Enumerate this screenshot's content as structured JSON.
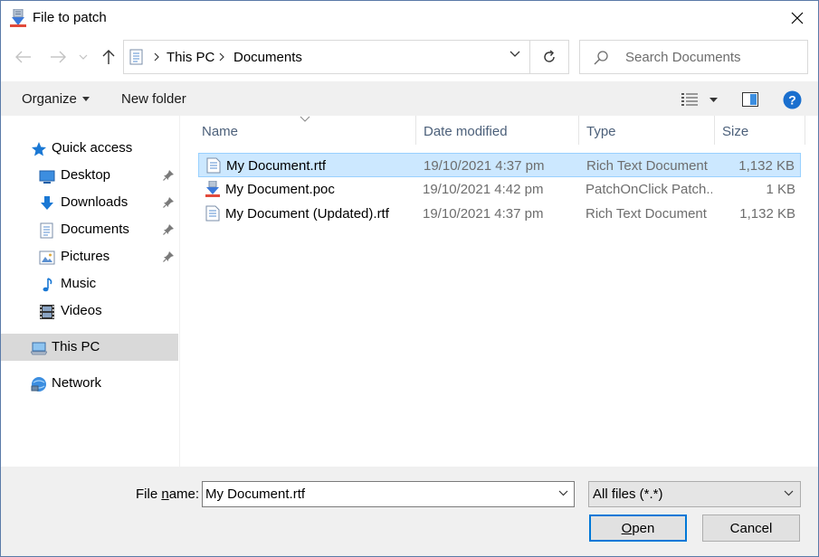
{
  "window": {
    "title": "File to patch",
    "close_glyph": "✕"
  },
  "nav": {
    "breadcrumbs": [
      "This PC",
      "Documents"
    ],
    "search_placeholder": "Search Documents"
  },
  "commands": {
    "organize": "Organize",
    "new_folder": "New folder",
    "help_glyph": "?"
  },
  "sidebar": {
    "items": [
      {
        "label": "Quick access",
        "icon": "star-icon"
      },
      {
        "label": "Desktop",
        "icon": "desktop-icon",
        "pinned": true
      },
      {
        "label": "Downloads",
        "icon": "download-icon",
        "pinned": true
      },
      {
        "label": "Documents",
        "icon": "documents-icon",
        "pinned": true
      },
      {
        "label": "Pictures",
        "icon": "pictures-icon",
        "pinned": true
      },
      {
        "label": "Music",
        "icon": "music-icon"
      },
      {
        "label": "Videos",
        "icon": "videos-icon"
      },
      {
        "label": "This PC",
        "icon": "computer-icon",
        "selected": true
      },
      {
        "label": "Network",
        "icon": "network-icon"
      }
    ]
  },
  "table": {
    "columns": [
      "Name",
      "Date modified",
      "Type",
      "Size"
    ],
    "rows": [
      {
        "name": "My Document.rtf",
        "date": "19/10/2021 4:37 pm",
        "type": "Rich Text Document",
        "size": "1,132 KB",
        "icon": "rtf-file-icon",
        "selected": true
      },
      {
        "name": "My Document.poc",
        "date": "19/10/2021 4:42 pm",
        "type": "PatchOnClick Patch...",
        "size": "1 KB",
        "icon": "patch-file-icon"
      },
      {
        "name": "My Document (Updated).rtf",
        "date": "19/10/2021 4:37 pm",
        "type": "Rich Text Document",
        "size": "1,132 KB",
        "icon": "rtf-file-icon"
      }
    ]
  },
  "footer": {
    "file_name_label_prefix": "File ",
    "file_name_label_access": "n",
    "file_name_label_suffix": "ame:",
    "file_name_value": "My Document.rtf",
    "filter": "All files (*.*)",
    "open_access": "O",
    "open_rest": "pen",
    "cancel": "Cancel"
  },
  "colors": {
    "accent": "#0078d7",
    "selection": "#cce8ff",
    "header_text": "#4c607a"
  }
}
